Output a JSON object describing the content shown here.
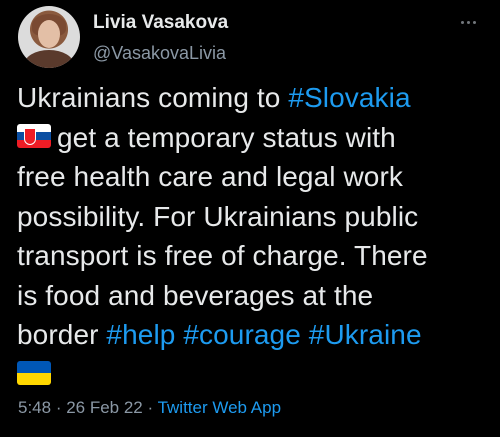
{
  "author": {
    "name": "Livia Vasakova",
    "handle": "@VasakovaLivia"
  },
  "tweet": {
    "line1_text": "Ukrainians coming to ",
    "line1_hashtag": "#Slovakia",
    "line2_text": "get a temporary status with",
    "line3_text": "free health care and legal work",
    "line4_text": "possibility. For Ukrainians public",
    "line5_text": "transport is free of charge. There",
    "line6_text": "is food and beverages at the",
    "line7_text": "border ",
    "hashtags_end": [
      "#help",
      "#courage",
      "#Ukraine"
    ],
    "flag_1": "slovakia-flag-icon",
    "flag_2": "ukraine-flag-icon"
  },
  "meta": {
    "time": "5:48",
    "separator": " · ",
    "date": "26 Feb 22",
    "app": "Twitter Web App"
  },
  "colors": {
    "background": "#000000",
    "text": "#e7e9ea",
    "secondary": "#8b98a5",
    "link": "#1d9bf0"
  }
}
